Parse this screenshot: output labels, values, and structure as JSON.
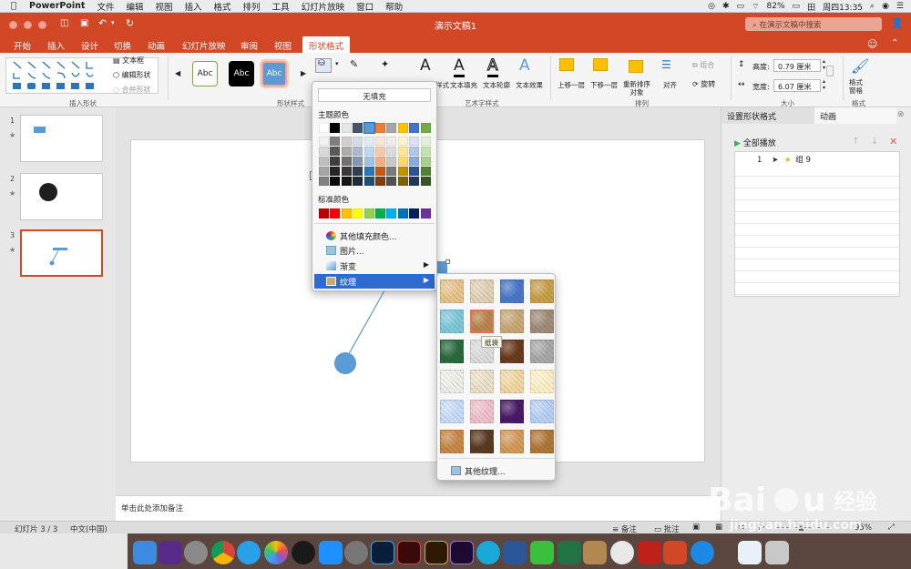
{
  "menubar": {
    "app": "PowerPoint",
    "items": [
      "文件",
      "编辑",
      "视图",
      "插入",
      "格式",
      "排列",
      "工具",
      "幻灯片放映",
      "窗口",
      "帮助"
    ],
    "battery": "82%",
    "clock": "周四13:35"
  },
  "window": {
    "title": "演示文稿1",
    "search_placeholder": "在演示文稿中搜索"
  },
  "tabs": [
    "开始",
    "插入",
    "设计",
    "切换",
    "动画",
    "幻灯片放映",
    "审阅",
    "视图",
    "形状格式"
  ],
  "active_tab": "形状格式",
  "ribbon": {
    "textbox": "文本框",
    "edit_shape": "编辑形状",
    "merge_shapes": "合并形状",
    "insert_shapes_label": "插入形状",
    "shape_styles_label": "形状样式",
    "abc_sample": "Abc",
    "wordart_styles": "样式",
    "text_fill": "文本填充",
    "text_outline": "文本轮廓",
    "text_effects": "文本效果",
    "wordart_label": "艺术字样式",
    "bring_forward": "上移一层",
    "send_backward": "下移一层",
    "reorder_line1": "重新排序",
    "reorder_line2": "对象",
    "align": "对齐",
    "group": "组合",
    "rotate": "旋转",
    "arrange_label": "排列",
    "height_label": "高度:",
    "height_value": "0.79 厘米",
    "width_label": "宽度:",
    "width_value": "6.07 厘米",
    "size_label": "大小",
    "format_pane_line1": "格式",
    "format_pane_line2": "窗格",
    "format_label": "格式"
  },
  "slides": [
    {
      "num": "1",
      "star": "★"
    },
    {
      "num": "2",
      "star": "★"
    },
    {
      "num": "3",
      "star": "★"
    }
  ],
  "notes_placeholder": "单击此处添加备注",
  "right_panel": {
    "tab_format": "设置形状格式",
    "tab_anim": "动画",
    "play_all": "全部播放",
    "anim_item_num": "1",
    "anim_item_name": "组 9"
  },
  "statusbar": {
    "slide_info": "幻灯片 3 / 3",
    "language": "中文(中国)",
    "notes": "备注",
    "comments": "批注",
    "zoom": "95%"
  },
  "color_menu": {
    "no_fill": "无填充",
    "theme_colors": "主题颜色",
    "standard_colors": "标准颜色",
    "more_colors": "其他填充颜色...",
    "picture": "图片...",
    "gradient": "渐变",
    "texture": "纹理",
    "theme_top": [
      "#ffffff",
      "#000000",
      "#e7e6e6",
      "#44546a",
      "#5b9bd5",
      "#ed7d31",
      "#a5a5a5",
      "#ffc000",
      "#4472c4",
      "#70ad47"
    ],
    "theme_shades": [
      [
        "#f2f2f2",
        "#7f7f7f",
        "#d0cece",
        "#d6dce4",
        "#deebf6",
        "#fbe5d5",
        "#ededed",
        "#fff2cc",
        "#d9e2f3",
        "#e2efd9"
      ],
      [
        "#d8d8d8",
        "#595959",
        "#aeabab",
        "#adb9ca",
        "#bdd7ee",
        "#f7caac",
        "#dbdbdb",
        "#fee599",
        "#b4c6e7",
        "#c5e0b3"
      ],
      [
        "#bfbfbf",
        "#3f3f3f",
        "#757070",
        "#8496b0",
        "#9cc3e5",
        "#f4b083",
        "#c9c9c9",
        "#ffd965",
        "#8eaadb",
        "#a8d08d"
      ],
      [
        "#a5a5a5",
        "#262626",
        "#3a3838",
        "#323f4f",
        "#2e75b5",
        "#c55a11",
        "#7b7b7b",
        "#bf9000",
        "#2f5496",
        "#538135"
      ],
      [
        "#7f7f7f",
        "#0c0c0c",
        "#171616",
        "#222a35",
        "#1f4e79",
        "#833c0b",
        "#525252",
        "#7f6000",
        "#1f3864",
        "#375623"
      ]
    ],
    "standard": [
      "#c00000",
      "#ff0000",
      "#ffc000",
      "#ffff00",
      "#92d050",
      "#00b050",
      "#00b0f0",
      "#0070c0",
      "#002060",
      "#7030a0"
    ]
  },
  "texture_menu": {
    "tooltip": "纸袋",
    "more_textures": "其他纹理...",
    "textures": [
      "#e8c48a",
      "#e0d2b4",
      "#4a78c8",
      "#c8a04a",
      "#7ec8d8",
      "#b8874e",
      "#c9a878",
      "#a08c78",
      "#2a6a3e",
      "#dcdcdc",
      "#6a3a1e",
      "#a8a8a8",
      "#eeeeea",
      "#ebe0c8",
      "#f0d8a4",
      "#fff0c8",
      "#c8dcf8",
      "#f0c0cc",
      "#4a1a68",
      "#b8d0f4",
      "#c88848",
      "#5a3a22",
      "#d49a5a",
      "#b07838"
    ]
  }
}
